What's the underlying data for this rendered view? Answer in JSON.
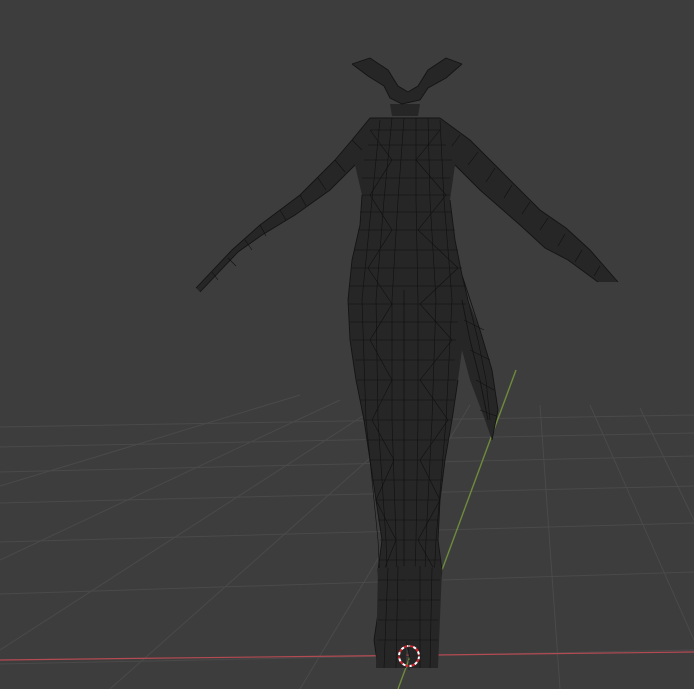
{
  "viewport": {
    "background_color": "#3d3d3d",
    "grid_color": "#4a4a4a",
    "x_axis_color": "#b44a52",
    "y_axis_color": "#6e8b3d",
    "mesh_color": "#1a1a1a"
  },
  "objects": [
    {
      "name": "character-mesh",
      "display": "wireframe"
    }
  ],
  "cursor": {
    "icon": "3d-cursor-icon"
  }
}
